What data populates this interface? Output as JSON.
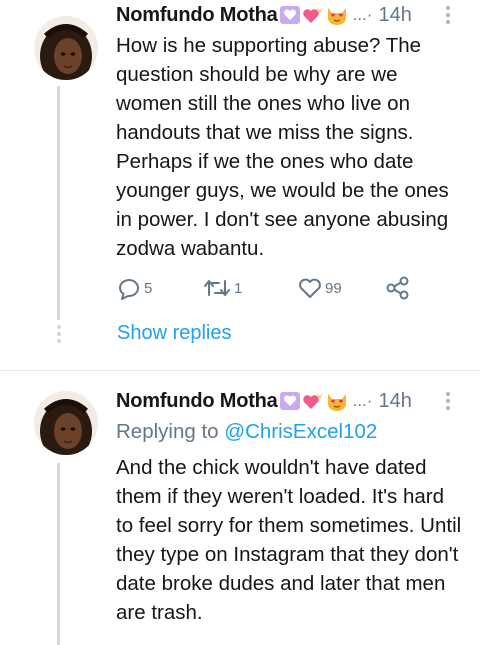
{
  "colors": {
    "link": "#1da1f2",
    "muted": "#657786",
    "text": "#14171a",
    "thread": "#cfd9de"
  },
  "tweets": [
    {
      "author": "Nomfundo Motha",
      "emoji_icons": [
        "purple-heart-icon",
        "heart-with-ribbon-icon",
        "heart-eyes-cat-icon"
      ],
      "ellipsis": "...",
      "separator": "·",
      "time": "14h",
      "text": "How is he supporting abuse? The question should be why are we women still the ones who live on handouts that we miss the signs. Perhaps if we the ones who date younger guys, we would be the ones in power. I don't see anyone abusing zodwa wabantu.",
      "replies": "5",
      "retweets": "1",
      "likes": "99",
      "show_replies": "Show replies"
    },
    {
      "author": "Nomfundo Motha",
      "emoji_icons": [
        "purple-heart-icon",
        "heart-with-ribbon-icon",
        "heart-eyes-cat-icon"
      ],
      "ellipsis": "...",
      "separator": "·",
      "time": "14h",
      "replying_prefix": "Replying to",
      "replying_handle": "@ChrisExcel102",
      "text": "And the chick wouldn't have dated them if they weren't loaded. It's hard to feel sorry for them sometimes. Until they type on Instagram that they don't date broke dudes and later that men are trash."
    }
  ]
}
